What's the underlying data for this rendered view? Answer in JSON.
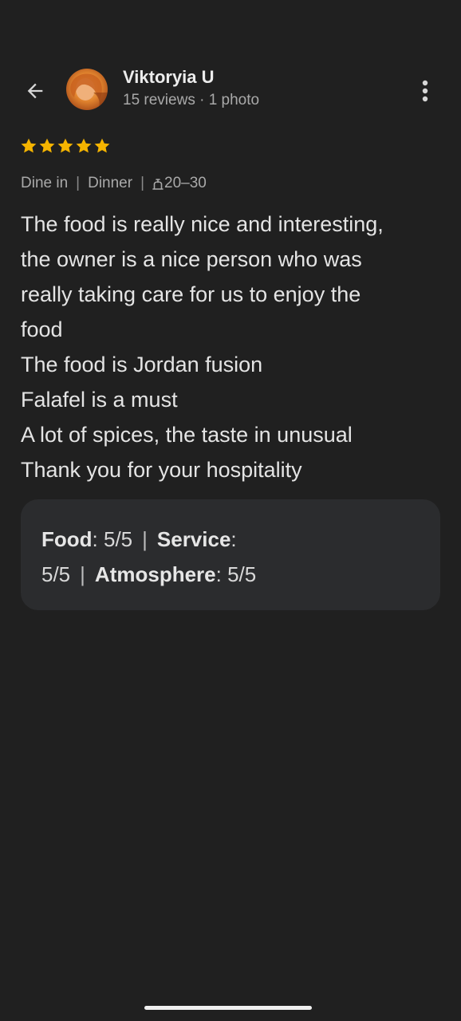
{
  "header": {
    "user_name": "Viktoryia U",
    "user_meta": "15 reviews · 1 photo",
    "back_icon": "arrow-left-icon",
    "more_icon": "more-vertical-icon"
  },
  "rating": {
    "stars": 5,
    "max_stars": 5,
    "star_color": "#f5b400"
  },
  "tags": {
    "service_type": "Dine in",
    "meal": "Dinner",
    "price_range": "20–30"
  },
  "review_lines": [
    "The food is really nice and interesting,",
    "the owner is a nice person who was",
    "really taking care for us to enjoy the",
    "food",
    "The food is Jordan fusion",
    "Falafel is a must",
    "A lot of spices, the taste in unusual",
    "Thank you for your hospitality"
  ],
  "ratings_box": {
    "food_label": "Food",
    "food_value": ": 5/5",
    "service_label": "Service",
    "service_value_a": ":",
    "service_value_b": "5/5",
    "atmosphere_label": "Atmosphere",
    "atmosphere_value": ": 5/5",
    "separator": "|"
  },
  "colors": {
    "background": "#202020",
    "card": "#2b2c2e",
    "accent_star": "#f5b400"
  }
}
